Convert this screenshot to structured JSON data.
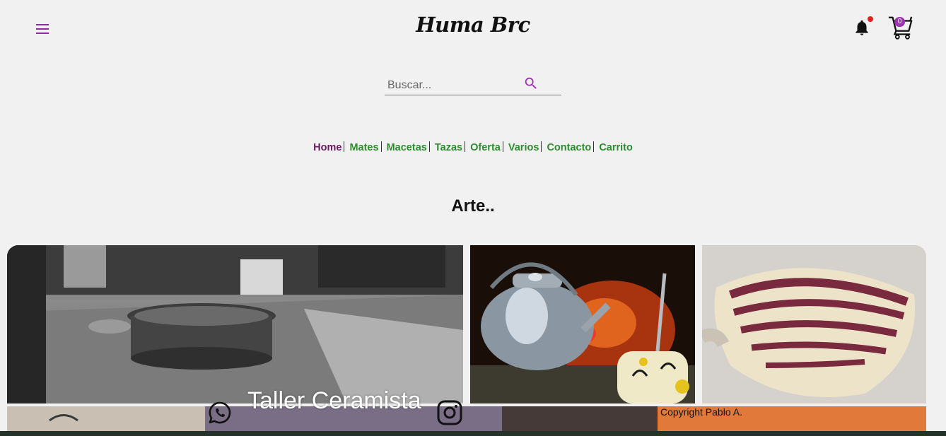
{
  "header": {
    "logo": "Huma Brc",
    "cart_count": "0",
    "notification_active": true
  },
  "search": {
    "placeholder": "Buscar...",
    "value": ""
  },
  "nav": {
    "items": [
      "Home",
      "Mates",
      "Macetas",
      "Tazas",
      "Oferta",
      "Varios",
      "Contacto",
      "Carrito"
    ],
    "active": "Home"
  },
  "main": {
    "heading": "Arte..",
    "gallery_caption": "Taller Ceramista"
  },
  "footer": {
    "copyright": "Copyright Pablo A.",
    "social_icons": [
      "whatsapp-icon",
      "instagram-icon"
    ]
  },
  "colors": {
    "accent": "#9c35b0",
    "nav_link": "#2e8b2e",
    "nav_active": "#6a1a5e",
    "notification_dot": "#e02020",
    "background": "#f1f1f1"
  }
}
